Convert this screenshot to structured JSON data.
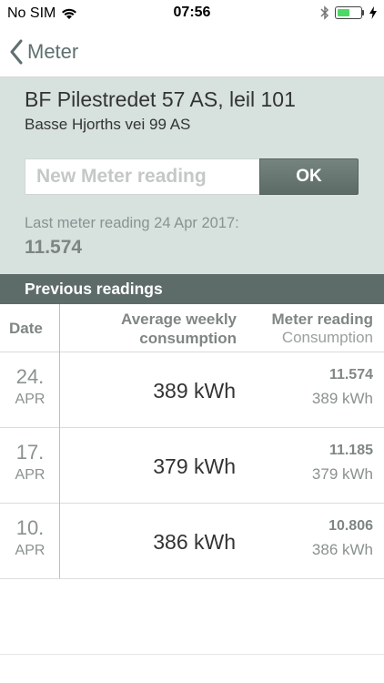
{
  "status_bar": {
    "carrier": "No SIM",
    "time": "07:56",
    "battery_level": 0.55,
    "icons": [
      "wifi-icon",
      "bluetooth-icon",
      "battery-icon",
      "charging-icon"
    ]
  },
  "nav": {
    "back_label": "Meter"
  },
  "header": {
    "title": "BF Pilestredet 57 AS, leil 101",
    "address": "Basse Hjorths vei 99 AS",
    "input_placeholder": "New Meter reading",
    "input_value": "",
    "ok_label": "OK",
    "last_reading_label": "Last meter reading 24 Apr 2017:",
    "last_reading_value": "11.574"
  },
  "previous": {
    "section_title": "Previous readings",
    "columns": {
      "date": "Date",
      "avg_line1": "Average weekly",
      "avg_line2": "consumption",
      "meter_title": "Meter reading",
      "meter_sub": "Consumption"
    },
    "rows": [
      {
        "day": "24.",
        "month": "APR",
        "avg": "389 kWh",
        "meter": "11.574",
        "consumption": "389 kWh"
      },
      {
        "day": "17.",
        "month": "APR",
        "avg": "379 kWh",
        "meter": "11.185",
        "consumption": "379 kWh"
      },
      {
        "day": "10.",
        "month": "APR",
        "avg": "386 kWh",
        "meter": "10.806",
        "consumption": "386 kWh"
      }
    ]
  },
  "colors": {
    "header_bg": "#d7e2df",
    "section_bar": "#5e6c69",
    "accent_line": "#a9c8c0"
  }
}
